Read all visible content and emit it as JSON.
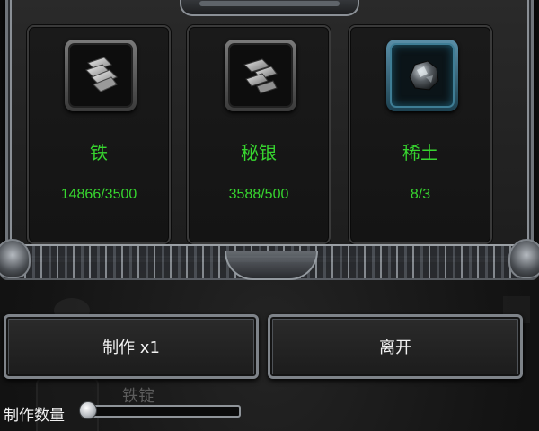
{
  "background": {
    "item_title": "铁锭"
  },
  "resources": [
    {
      "name": "铁",
      "count": "14866/3500",
      "icon": "iron-ore-icon",
      "rarity": "common"
    },
    {
      "name": "秘银",
      "count": "3588/500",
      "icon": "mithril-ore-icon",
      "rarity": "common"
    },
    {
      "name": "稀土",
      "count": "8/3",
      "icon": "rare-earth-icon",
      "rarity": "rare"
    }
  ],
  "actions": {
    "craft_label": "制作 x1",
    "leave_label": "离开"
  },
  "quantity": {
    "label": "制作数量",
    "value_fraction": 0.0
  },
  "colors": {
    "resource_text": "#37d62f",
    "rare_frame": "#3e7d95",
    "panel_border": "#8a8f95"
  }
}
